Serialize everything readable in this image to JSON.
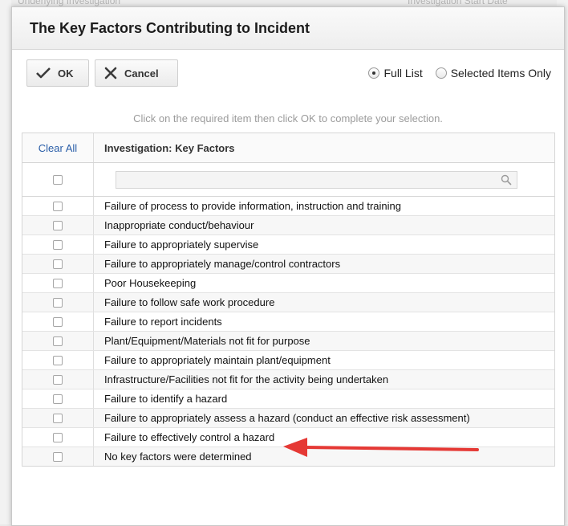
{
  "background": {
    "left_label": "Underlying Investigation",
    "right_label": "Investigation Start Date"
  },
  "dialog": {
    "title": "The Key Factors Contributing to Incident"
  },
  "toolbar": {
    "ok_label": "OK",
    "cancel_label": "Cancel",
    "radio_full_list": "Full List",
    "radio_selected_only": "Selected Items Only",
    "selected_option": "Full List"
  },
  "instructions": "Click on the required item then click OK to complete your selection.",
  "table": {
    "clear_all_label": "Clear All",
    "column_header": "Investigation: Key Factors",
    "search_value": "",
    "items": [
      "Failure of process to provide information, instruction and training",
      "Inappropriate conduct/behaviour",
      "Failure to appropriately supervise",
      "Failure to appropriately manage/control contractors",
      "Poor Housekeeping",
      "Failure to follow safe work procedure",
      "Failure to report incidents",
      "Plant/Equipment/Materials not fit for purpose",
      "Failure to appropriately maintain plant/equipment",
      "Infrastructure/Facilities not fit for the activity being undertaken",
      "Failure to identify a hazard",
      "Failure to appropriately assess a hazard (conduct an effective risk assessment)",
      "Failure to effectively control a hazard",
      "No key factors were determined"
    ]
  },
  "icons": {
    "ok": "check-icon",
    "cancel": "close-icon",
    "search": "search-icon",
    "annotation": "red-arrow-icon"
  },
  "colors": {
    "link": "#2a5ea8",
    "annotation_arrow": "#e53935",
    "instructions_text": "#9b9b9b"
  }
}
